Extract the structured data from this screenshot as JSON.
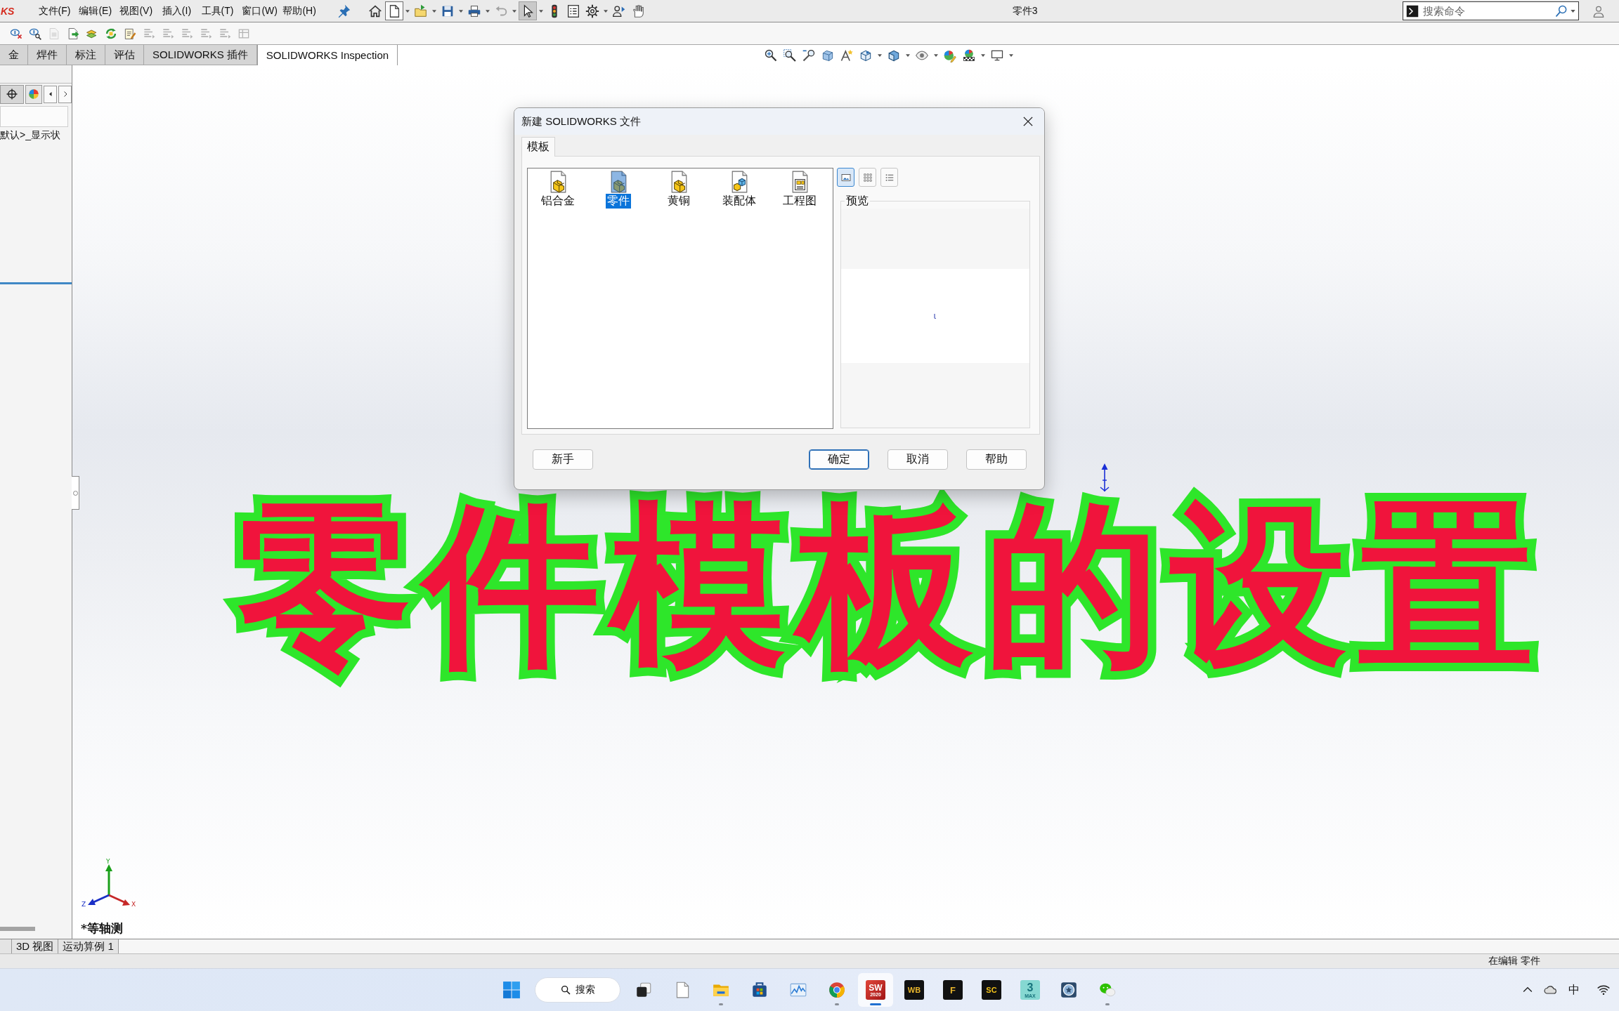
{
  "title_bar": {
    "logo": "KS",
    "menus": [
      "文件(F)",
      "编辑(E)",
      "视图(V)",
      "插入(I)",
      "工具(T)",
      "窗口(W)",
      "帮助(H)"
    ],
    "quick_tools": [
      {
        "kind": "pin",
        "dropdown": false,
        "hovered": false,
        "pressed": false,
        "disabled": false
      },
      {
        "kind": "home",
        "dropdown": false,
        "hovered": false,
        "pressed": false,
        "disabled": false
      },
      {
        "kind": "new",
        "dropdown": true,
        "hovered": true,
        "pressed": false,
        "disabled": false
      },
      {
        "kind": "open",
        "dropdown": true,
        "hovered": false,
        "pressed": false,
        "disabled": false
      },
      {
        "kind": "save",
        "dropdown": true,
        "hovered": false,
        "pressed": false,
        "disabled": false
      },
      {
        "kind": "print",
        "dropdown": true,
        "hovered": false,
        "pressed": false,
        "disabled": false
      },
      {
        "kind": "undo",
        "dropdown": true,
        "hovered": false,
        "pressed": false,
        "disabled": true
      },
      {
        "kind": "select",
        "dropdown": true,
        "hovered": false,
        "pressed": true,
        "disabled": false
      },
      {
        "kind": "traffic_light",
        "dropdown": false,
        "hovered": false,
        "pressed": false,
        "disabled": false
      },
      {
        "kind": "list",
        "dropdown": false,
        "hovered": false,
        "pressed": false,
        "disabled": false
      },
      {
        "kind": "gear",
        "dropdown": true,
        "hovered": false,
        "pressed": false,
        "disabled": false
      },
      {
        "kind": "user_arrow",
        "dropdown": false,
        "hovered": false,
        "pressed": false,
        "disabled": false
      },
      {
        "kind": "hand",
        "dropdown": false,
        "hovered": false,
        "pressed": false,
        "disabled": false
      }
    ],
    "document_title": "零件3",
    "search": {
      "placeholder": "搜索命令"
    }
  },
  "toolbar": [
    {
      "kind": "hide_dim",
      "disabled": false
    },
    {
      "kind": "find_dim",
      "disabled": false
    },
    {
      "kind": "doc_grey",
      "disabled": true
    },
    {
      "kind": "doc_arrow",
      "disabled": false
    },
    {
      "kind": "mate_block",
      "disabled": false
    },
    {
      "kind": "rebuild",
      "disabled": false
    },
    {
      "kind": "notes",
      "disabled": false
    },
    {
      "kind": "align",
      "disabled": true
    },
    {
      "kind": "align",
      "disabled": true
    },
    {
      "kind": "align",
      "disabled": true
    },
    {
      "kind": "align",
      "disabled": true
    },
    {
      "kind": "align",
      "disabled": true
    },
    {
      "kind": "table",
      "disabled": true
    }
  ],
  "command_tabs": [
    {
      "label": "金",
      "selected": false
    },
    {
      "label": "焊件",
      "selected": false
    },
    {
      "label": "标注",
      "selected": false
    },
    {
      "label": "评估",
      "selected": false
    },
    {
      "label": "SOLIDWORKS 插件",
      "selected": false
    },
    {
      "label": "SOLIDWORKS Inspection",
      "selected": true
    }
  ],
  "view_tools": [
    {
      "kind": "zoom_fit",
      "dropdown": false
    },
    {
      "kind": "zoom_area",
      "dropdown": false
    },
    {
      "kind": "previous_view",
      "dropdown": false
    },
    {
      "kind": "section",
      "dropdown": false
    },
    {
      "kind": "annotation",
      "dropdown": false
    },
    {
      "kind": "orientation",
      "dropdown": true
    },
    {
      "kind": "display_style",
      "dropdown": true
    },
    {
      "kind": "hide_show",
      "dropdown": true
    },
    {
      "kind": "appearance",
      "dropdown": false
    },
    {
      "kind": "scene",
      "dropdown": true
    },
    {
      "kind": "monitor",
      "dropdown": true
    }
  ],
  "feature_manager": {
    "configuration": "默认>_显示状"
  },
  "canvas": {
    "caption": "零件模板的设置",
    "view_name": "*等轴测",
    "triad": {
      "x": "X",
      "y": "Y",
      "z": "Z"
    }
  },
  "dialog": {
    "title": "新建 SOLIDWORKS 文件",
    "tabs": [
      {
        "label": "模板",
        "selected": true
      }
    ],
    "templates": [
      {
        "label": "铝合金",
        "kind": "part",
        "selected": false
      },
      {
        "label": "零件",
        "kind": "part",
        "selected": true
      },
      {
        "label": "黄铜",
        "kind": "part",
        "selected": false
      },
      {
        "label": "装配体",
        "kind": "assembly",
        "selected": false
      },
      {
        "label": "工程图",
        "kind": "drawing",
        "selected": false
      }
    ],
    "view_modes": [
      {
        "kind": "large",
        "selected": true
      },
      {
        "kind": "icons",
        "selected": false
      },
      {
        "kind": "list",
        "selected": false
      }
    ],
    "preview": {
      "label": "预览"
    },
    "buttons": [
      {
        "label": "新手",
        "default": false
      },
      {
        "label": "确定",
        "default": true
      },
      {
        "label": "取消",
        "default": false
      },
      {
        "label": "帮助",
        "default": false
      }
    ]
  },
  "bottom_tabs": [
    {
      "label": "3D 视图",
      "selected": false
    },
    {
      "label": "运动算例 1",
      "selected": false
    }
  ],
  "status_bar": {
    "text": "在编辑 零件"
  },
  "taskbar": {
    "search_label": "搜索",
    "apps": [
      {
        "kind": "task_view",
        "running": false,
        "active": false
      },
      {
        "kind": "notepad",
        "running": false,
        "active": false
      },
      {
        "kind": "explorer",
        "running": true,
        "active": false
      },
      {
        "kind": "store",
        "running": false,
        "active": false
      },
      {
        "kind": "perf_monitor",
        "running": false,
        "active": false
      },
      {
        "kind": "chrome",
        "running": true,
        "active": false
      },
      {
        "kind": "solidworks",
        "mark": "SW",
        "sub": "2020",
        "running": true,
        "active": true
      },
      {
        "kind": "workbench",
        "mark": "WB",
        "running": false,
        "active": false
      },
      {
        "kind": "f_app",
        "mark": "F",
        "running": false,
        "active": false
      },
      {
        "kind": "sc_app",
        "mark": "SC",
        "running": false,
        "active": false
      },
      {
        "kind": "max",
        "mark": "3",
        "sub": "MAX",
        "running": false,
        "active": false
      },
      {
        "kind": "badge_app",
        "running": false,
        "active": false
      },
      {
        "kind": "wechat",
        "running": true,
        "active": false
      }
    ],
    "tray": {
      "ime": "中"
    }
  }
}
